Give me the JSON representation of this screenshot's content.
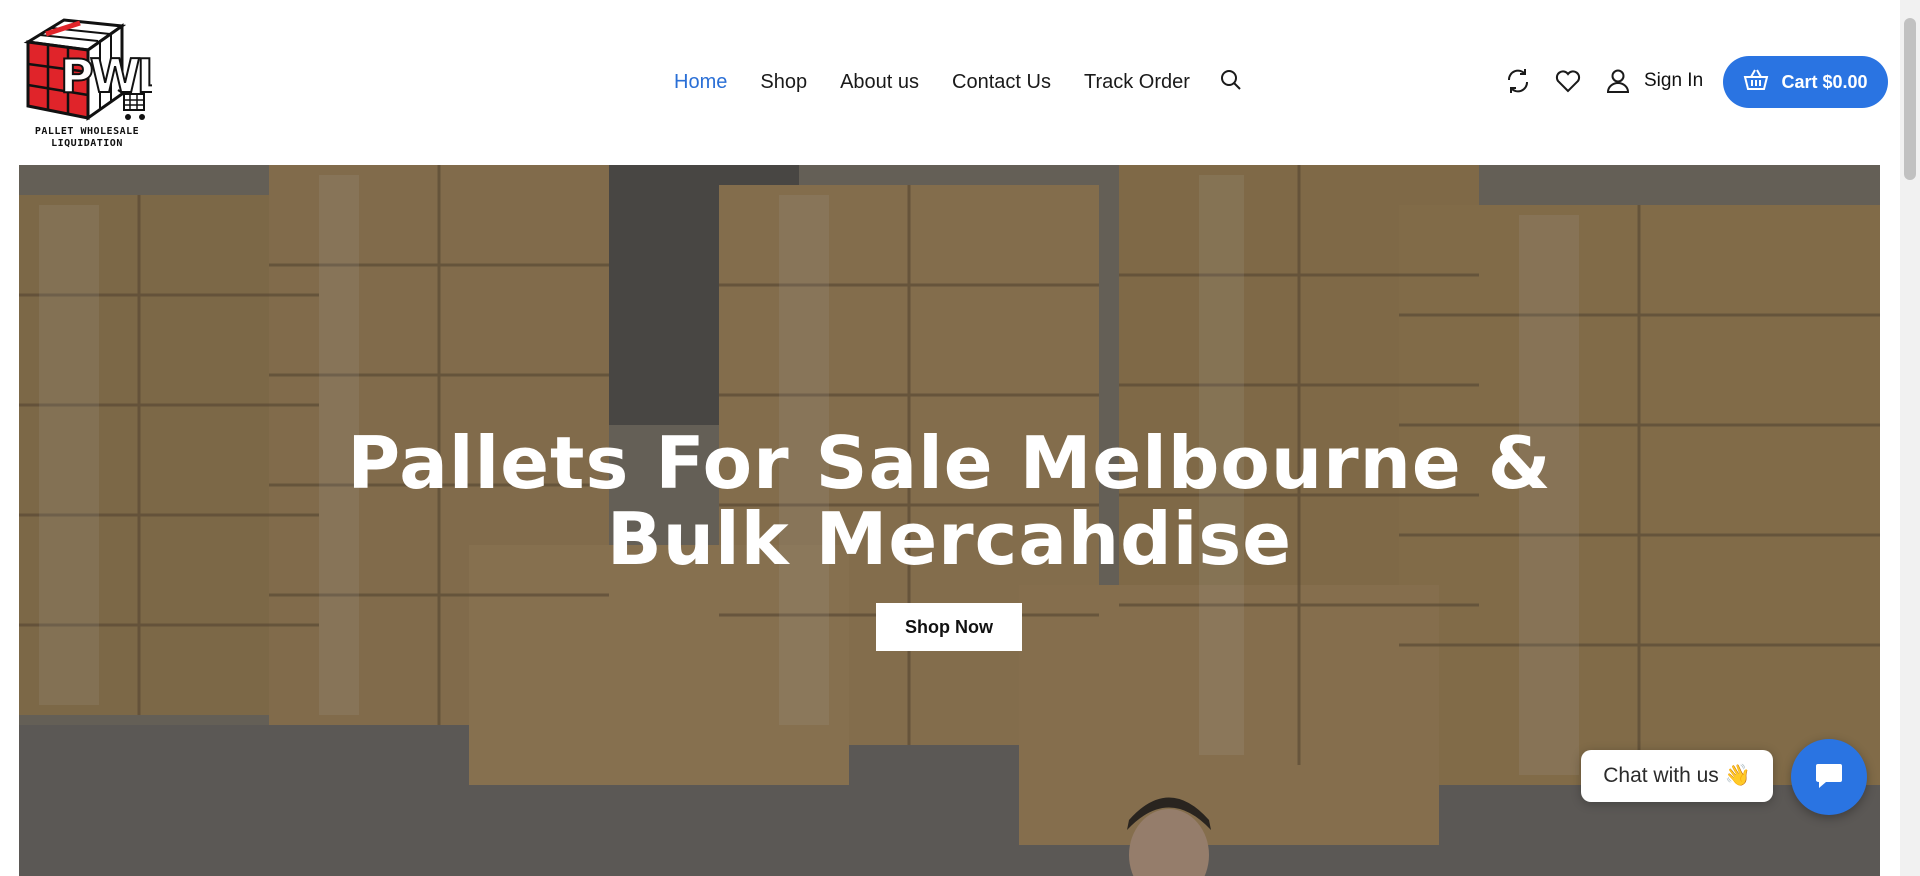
{
  "brand": {
    "logo_mark": "PWL",
    "logo_text_line1": "PALLET WHOLESALE",
    "logo_text_line2": "LIQUIDATION"
  },
  "nav": {
    "items": [
      {
        "label": "Home",
        "active": true
      },
      {
        "label": "Shop",
        "active": false
      },
      {
        "label": "About us",
        "active": false
      },
      {
        "label": "Contact Us",
        "active": false
      },
      {
        "label": "Track Order",
        "active": false
      }
    ],
    "search_icon": "search-icon"
  },
  "tools": {
    "compare_icon": "refresh-icon",
    "wishlist_icon": "heart-icon",
    "user_icon": "user-icon",
    "signin_label": "Sign In"
  },
  "cart": {
    "icon": "basket-icon",
    "label": "Cart $0.00"
  },
  "hero": {
    "title_line1": "Pallets For Sale Melbourne &",
    "title_line2": "Bulk Mercahdise",
    "cta_label": "Shop Now"
  },
  "chat": {
    "bubble_text": "Chat with us 👋",
    "button_icon": "chat-icon"
  },
  "colors": {
    "accent": "#2a74e2",
    "nav_active": "#2a6fd6",
    "logo_red": "#e0242a"
  }
}
